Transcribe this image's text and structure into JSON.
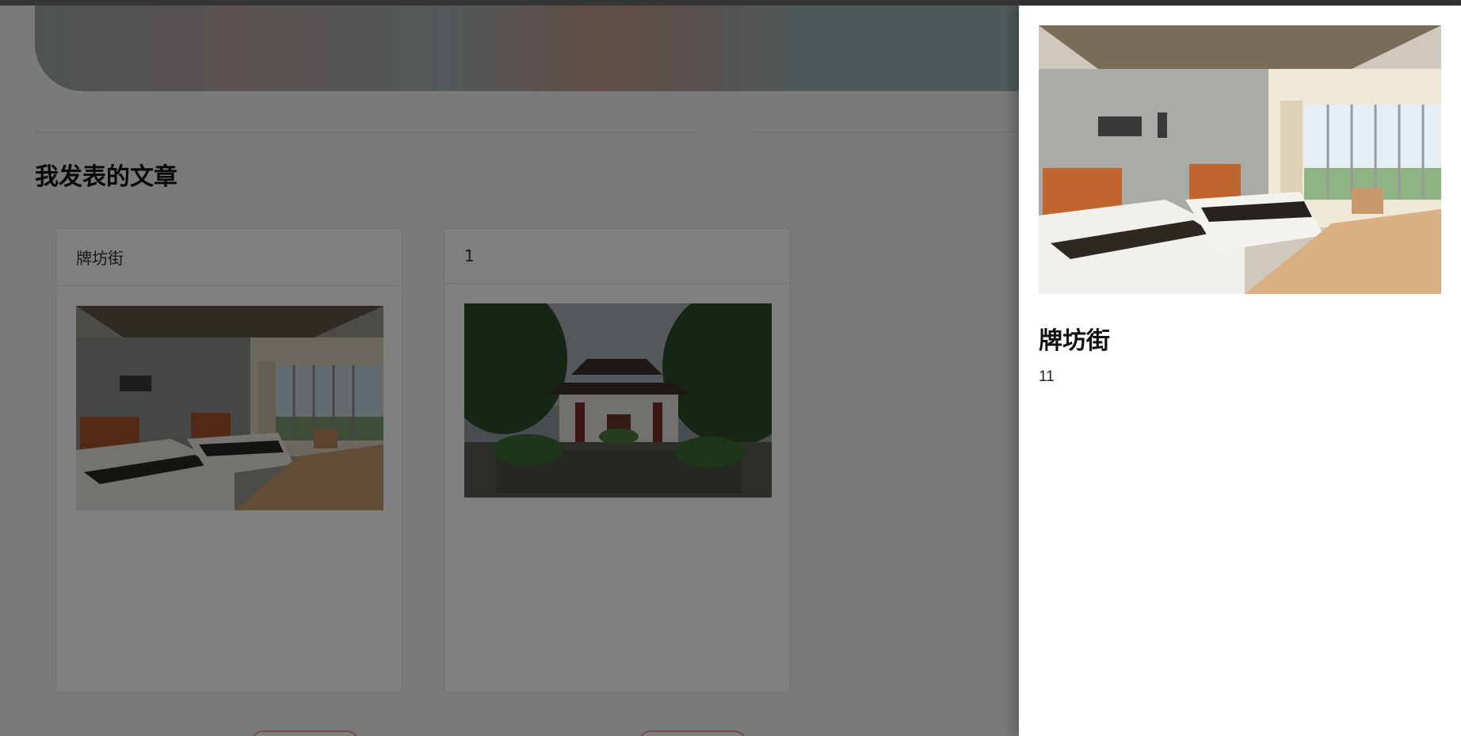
{
  "section": {
    "title": "我发表的文章"
  },
  "articles": [
    {
      "title": "牌坊街",
      "image": "hotel-room-photo"
    },
    {
      "title": "1",
      "image": "chinese-temple-gate-photo"
    }
  ],
  "drawer": {
    "title": "牌坊街",
    "content": "11",
    "image": "hotel-room-photo"
  },
  "colors": {
    "overlay": "rgba(0,0,0,0.5)",
    "button_border": "#e3a392",
    "drawer_bg": "#ffffff"
  }
}
